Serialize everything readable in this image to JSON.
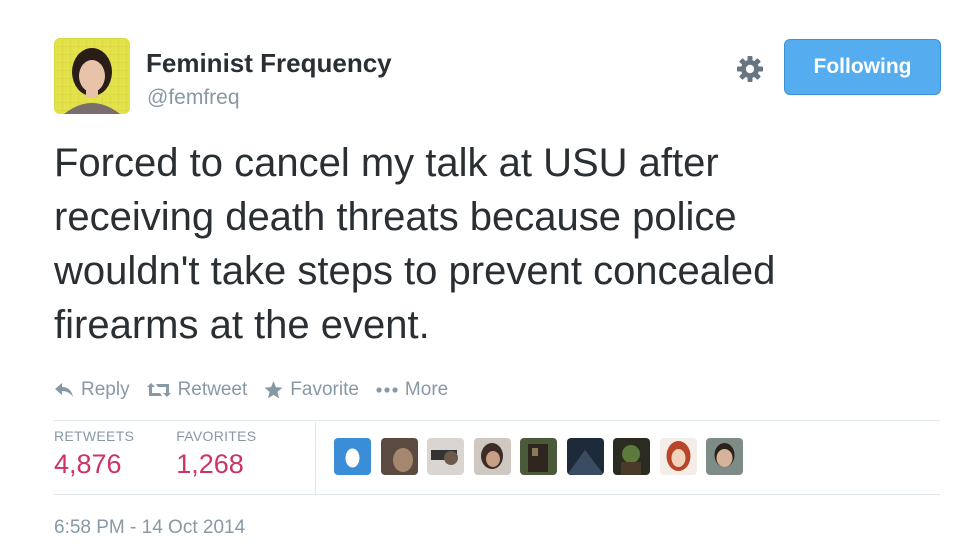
{
  "author": {
    "display_name": "Feminist Frequency",
    "handle": "@femfreq",
    "avatar_icon": "profile-photo"
  },
  "follow_button": {
    "label": "Following",
    "color": "#55acee"
  },
  "settings_icon": "gear-icon",
  "tweet": {
    "text": "Forced to cancel my talk at USU after\nreceiving death threats because police\nwouldn't take steps to prevent concealed\nfirearms at the event."
  },
  "actions": [
    {
      "label": "Reply",
      "icon": "reply-icon"
    },
    {
      "label": "Retweet",
      "icon": "retweet-icon"
    },
    {
      "label": "Favorite",
      "icon": "star-icon"
    },
    {
      "label": "More",
      "icon": "more-dots-icon"
    }
  ],
  "stats": {
    "retweets_label": "RETWEETS",
    "retweets_value": "4,876",
    "favorites_label": "FAVORITES",
    "favorites_value": "1,268"
  },
  "favoriters_count_shown": 9,
  "timestamp": "6:58 PM - 14 Oct 2014",
  "colors": {
    "text": "#292f33",
    "muted": "#8899a6",
    "stat_value": "#cc3366",
    "divider": "#e1e8ed"
  }
}
